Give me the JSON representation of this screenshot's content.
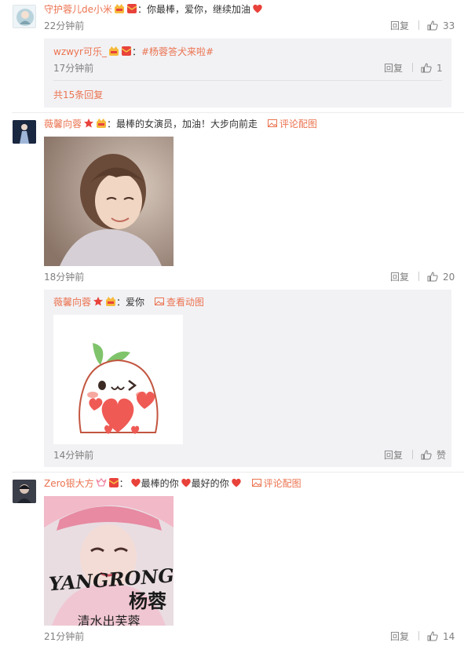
{
  "comments": [
    {
      "user": "守护蓉儿de小米",
      "text": "：你最棒，爱你，继续加油",
      "time": "22分钟前",
      "reply_label": "回复",
      "likes": "33",
      "sub": [
        {
          "user": "wzwyr可乐_",
          "colon": "：",
          "topic": "#杨蓉答犬来啦#",
          "time": "17分钟前",
          "reply_label": "回复",
          "likes": "1"
        }
      ],
      "more_replies": "共15条回复"
    },
    {
      "user": "薇馨向蓉",
      "text": "：最棒的女演员，加油！大步向前走",
      "pic_link": "评论配图",
      "time": "18分钟前",
      "reply_label": "回复",
      "likes": "20",
      "sub": [
        {
          "user": "薇馨向蓉",
          "text": "：爱你",
          "pic_link": "查看动图",
          "time": "14分钟前",
          "reply_label": "回复",
          "likes": "赞"
        }
      ]
    },
    {
      "user": "Zero银大方",
      "text_colon": "：",
      "text_a": "最棒的你",
      "text_b": "最好的你",
      "pic_link": "评论配图",
      "image_text_en": "YANGRONG",
      "image_text_cn": "杨蓉",
      "image_caption": "清水出芙蓉",
      "time": "21分钟前",
      "reply_label": "回复",
      "likes": "14"
    }
  ],
  "colors": {
    "link": "#eb7350",
    "time": "#808080",
    "reply_bg": "#f2f2f5",
    "heart": "#e8423b"
  },
  "icons": [
    "avatar",
    "vip-crown-icon",
    "red-envelope-icon",
    "heart-icon",
    "star-icon",
    "image-icon",
    "thumb-up-icon"
  ]
}
